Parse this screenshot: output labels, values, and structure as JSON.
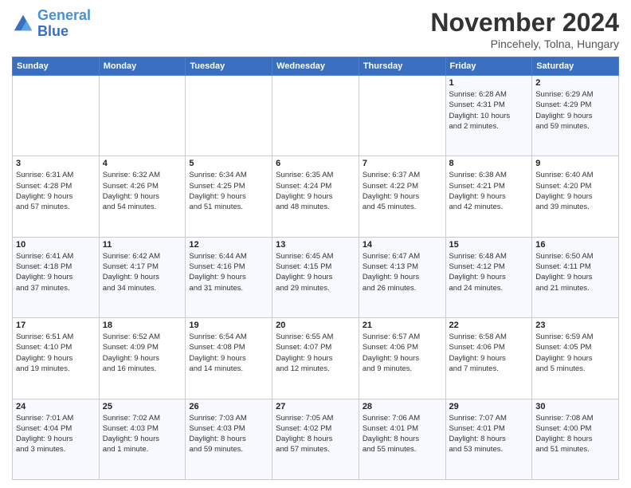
{
  "logo": {
    "line1": "General",
    "line2": "Blue"
  },
  "title": "November 2024",
  "subtitle": "Pincehely, Tolna, Hungary",
  "headers": [
    "Sunday",
    "Monday",
    "Tuesday",
    "Wednesday",
    "Thursday",
    "Friday",
    "Saturday"
  ],
  "weeks": [
    [
      {
        "day": "",
        "info": ""
      },
      {
        "day": "",
        "info": ""
      },
      {
        "day": "",
        "info": ""
      },
      {
        "day": "",
        "info": ""
      },
      {
        "day": "",
        "info": ""
      },
      {
        "day": "1",
        "info": "Sunrise: 6:28 AM\nSunset: 4:31 PM\nDaylight: 10 hours\nand 2 minutes."
      },
      {
        "day": "2",
        "info": "Sunrise: 6:29 AM\nSunset: 4:29 PM\nDaylight: 9 hours\nand 59 minutes."
      }
    ],
    [
      {
        "day": "3",
        "info": "Sunrise: 6:31 AM\nSunset: 4:28 PM\nDaylight: 9 hours\nand 57 minutes."
      },
      {
        "day": "4",
        "info": "Sunrise: 6:32 AM\nSunset: 4:26 PM\nDaylight: 9 hours\nand 54 minutes."
      },
      {
        "day": "5",
        "info": "Sunrise: 6:34 AM\nSunset: 4:25 PM\nDaylight: 9 hours\nand 51 minutes."
      },
      {
        "day": "6",
        "info": "Sunrise: 6:35 AM\nSunset: 4:24 PM\nDaylight: 9 hours\nand 48 minutes."
      },
      {
        "day": "7",
        "info": "Sunrise: 6:37 AM\nSunset: 4:22 PM\nDaylight: 9 hours\nand 45 minutes."
      },
      {
        "day": "8",
        "info": "Sunrise: 6:38 AM\nSunset: 4:21 PM\nDaylight: 9 hours\nand 42 minutes."
      },
      {
        "day": "9",
        "info": "Sunrise: 6:40 AM\nSunset: 4:20 PM\nDaylight: 9 hours\nand 39 minutes."
      }
    ],
    [
      {
        "day": "10",
        "info": "Sunrise: 6:41 AM\nSunset: 4:18 PM\nDaylight: 9 hours\nand 37 minutes."
      },
      {
        "day": "11",
        "info": "Sunrise: 6:42 AM\nSunset: 4:17 PM\nDaylight: 9 hours\nand 34 minutes."
      },
      {
        "day": "12",
        "info": "Sunrise: 6:44 AM\nSunset: 4:16 PM\nDaylight: 9 hours\nand 31 minutes."
      },
      {
        "day": "13",
        "info": "Sunrise: 6:45 AM\nSunset: 4:15 PM\nDaylight: 9 hours\nand 29 minutes."
      },
      {
        "day": "14",
        "info": "Sunrise: 6:47 AM\nSunset: 4:13 PM\nDaylight: 9 hours\nand 26 minutes."
      },
      {
        "day": "15",
        "info": "Sunrise: 6:48 AM\nSunset: 4:12 PM\nDaylight: 9 hours\nand 24 minutes."
      },
      {
        "day": "16",
        "info": "Sunrise: 6:50 AM\nSunset: 4:11 PM\nDaylight: 9 hours\nand 21 minutes."
      }
    ],
    [
      {
        "day": "17",
        "info": "Sunrise: 6:51 AM\nSunset: 4:10 PM\nDaylight: 9 hours\nand 19 minutes."
      },
      {
        "day": "18",
        "info": "Sunrise: 6:52 AM\nSunset: 4:09 PM\nDaylight: 9 hours\nand 16 minutes."
      },
      {
        "day": "19",
        "info": "Sunrise: 6:54 AM\nSunset: 4:08 PM\nDaylight: 9 hours\nand 14 minutes."
      },
      {
        "day": "20",
        "info": "Sunrise: 6:55 AM\nSunset: 4:07 PM\nDaylight: 9 hours\nand 12 minutes."
      },
      {
        "day": "21",
        "info": "Sunrise: 6:57 AM\nSunset: 4:06 PM\nDaylight: 9 hours\nand 9 minutes."
      },
      {
        "day": "22",
        "info": "Sunrise: 6:58 AM\nSunset: 4:06 PM\nDaylight: 9 hours\nand 7 minutes."
      },
      {
        "day": "23",
        "info": "Sunrise: 6:59 AM\nSunset: 4:05 PM\nDaylight: 9 hours\nand 5 minutes."
      }
    ],
    [
      {
        "day": "24",
        "info": "Sunrise: 7:01 AM\nSunset: 4:04 PM\nDaylight: 9 hours\nand 3 minutes."
      },
      {
        "day": "25",
        "info": "Sunrise: 7:02 AM\nSunset: 4:03 PM\nDaylight: 9 hours\nand 1 minute."
      },
      {
        "day": "26",
        "info": "Sunrise: 7:03 AM\nSunset: 4:03 PM\nDaylight: 8 hours\nand 59 minutes."
      },
      {
        "day": "27",
        "info": "Sunrise: 7:05 AM\nSunset: 4:02 PM\nDaylight: 8 hours\nand 57 minutes."
      },
      {
        "day": "28",
        "info": "Sunrise: 7:06 AM\nSunset: 4:01 PM\nDaylight: 8 hours\nand 55 minutes."
      },
      {
        "day": "29",
        "info": "Sunrise: 7:07 AM\nSunset: 4:01 PM\nDaylight: 8 hours\nand 53 minutes."
      },
      {
        "day": "30",
        "info": "Sunrise: 7:08 AM\nSunset: 4:00 PM\nDaylight: 8 hours\nand 51 minutes."
      }
    ]
  ]
}
